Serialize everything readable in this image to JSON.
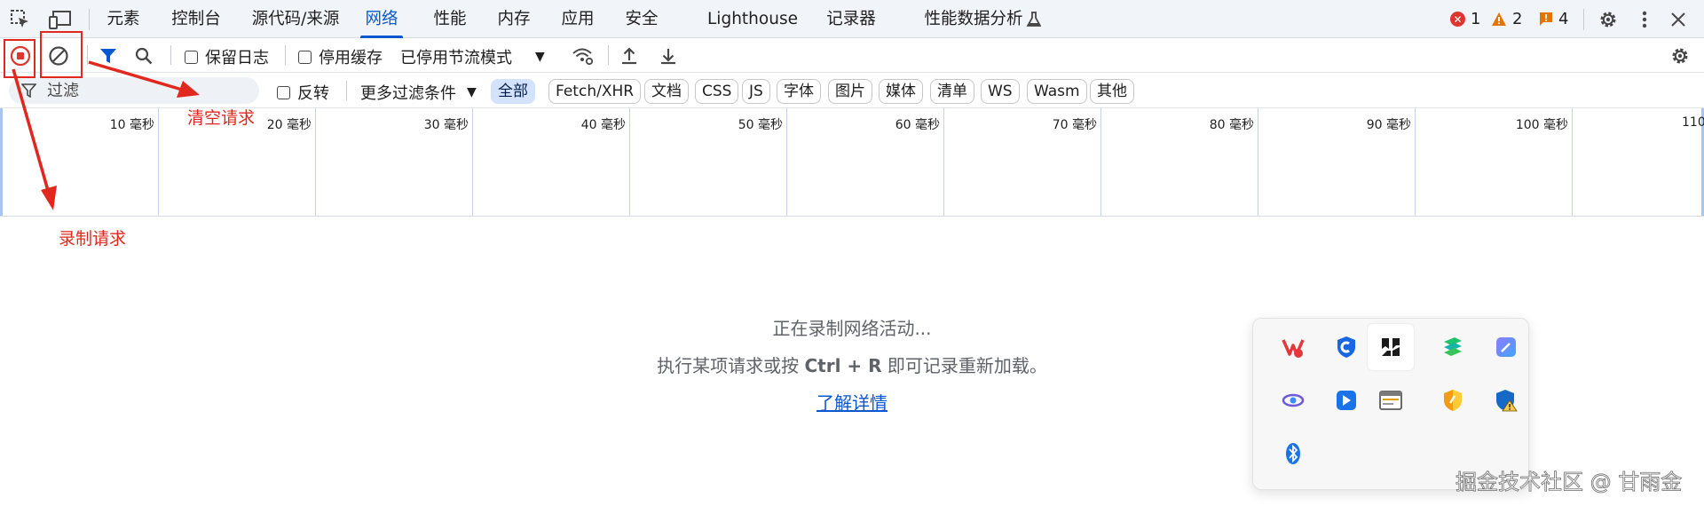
{
  "tabs": [
    {
      "label": "元素"
    },
    {
      "label": "控制台"
    },
    {
      "label": "源代码/来源"
    },
    {
      "label": "网络"
    },
    {
      "label": "性能"
    },
    {
      "label": "内存"
    },
    {
      "label": "应用"
    },
    {
      "label": "安全"
    },
    {
      "label": "Lighthouse"
    },
    {
      "label": "记录器"
    },
    {
      "label": "性能数据分析"
    }
  ],
  "active_tab": "网络",
  "status": {
    "errors": "1",
    "warnings": "2",
    "issues": "4"
  },
  "toolbar": {
    "preserve_log": "保留日志",
    "disable_cache": "停用缓存",
    "throttling": "已停用节流模式"
  },
  "filter": {
    "placeholder": "过滤",
    "invert": "反转",
    "more_filters": "更多过滤条件",
    "types": [
      "全部",
      "Fetch/XHR",
      "文档",
      "CSS",
      "JS",
      "字体",
      "图片",
      "媒体",
      "清单",
      "WS",
      "Wasm",
      "其他"
    ],
    "active_type": "全部"
  },
  "timeline": {
    "ticks": [
      "10 毫秒",
      "20 毫秒",
      "30 毫秒",
      "40 毫秒",
      "50 毫秒",
      "60 毫秒",
      "70 毫秒",
      "80 毫秒",
      "90 毫秒",
      "100 毫秒",
      "110"
    ]
  },
  "empty_state": {
    "line1": "正在录制网络活动...",
    "line2_prefix": "执行某项请求或按 ",
    "line2_keys": "Ctrl + R",
    "line2_suffix": " 即可记录重新加载。",
    "link": "了解详情"
  },
  "annotations": {
    "clear": "清空请求",
    "record": "录制请求",
    "color": "#e0281e"
  },
  "tray_icons": [
    "wps-icon",
    "shield-app-icon",
    "dark-app-icon",
    "stacked-layers-icon",
    "purple-edit-icon",
    "swirl-app-icon",
    "blue-arrow-app-icon",
    "window-app-icon",
    "orange-shield-icon",
    "defender-warning-icon",
    "bluetooth-icon"
  ],
  "watermark": "掘金技术社区 @ 甘雨金",
  "colors": {
    "accent": "#0b57d0",
    "error": "#dc362e",
    "warning": "#e37400"
  }
}
